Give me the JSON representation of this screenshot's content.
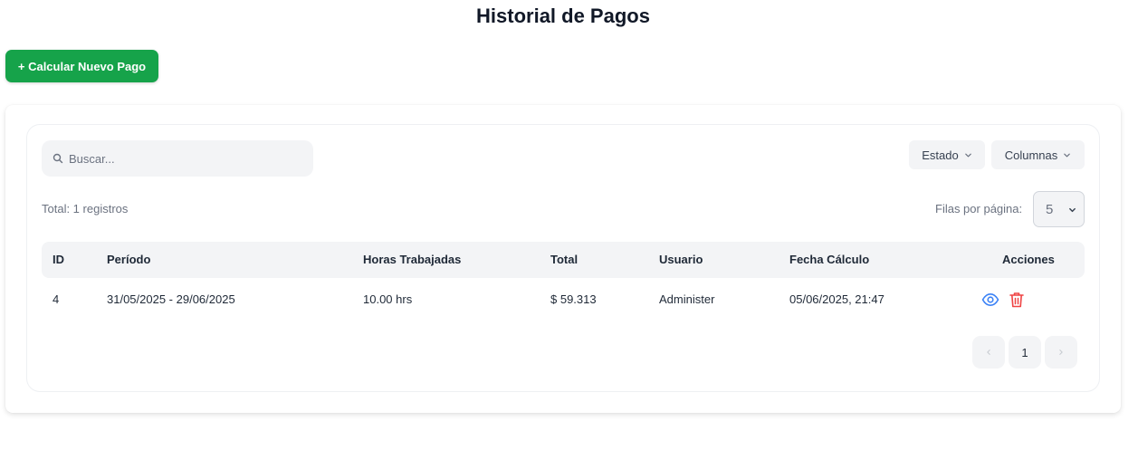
{
  "page": {
    "title": "Historial de Pagos"
  },
  "toolbar": {
    "new_label": "+ Calcular Nuevo Pago"
  },
  "search": {
    "placeholder": "Buscar...",
    "value": ""
  },
  "filters": {
    "estado_label": "Estado",
    "columnas_label": "Columnas"
  },
  "summary": {
    "total_text": "Total: 1 registros"
  },
  "pagination": {
    "rows_label": "Filas por página:",
    "rows_value": "5",
    "current_page": "1"
  },
  "table": {
    "headers": [
      "ID",
      "Período",
      "Horas Trabajadas",
      "Total",
      "Usuario",
      "Fecha Cálculo",
      "Acciones"
    ],
    "rows": [
      [
        "4",
        "31/05/2025 - 29/06/2025",
        "10.00 hrs",
        "$ 59.313",
        "Administer",
        "05/06/2025, 21:47"
      ]
    ]
  },
  "colors": {
    "primary_green": "#16a34a",
    "view_blue": "#3b82f6",
    "delete_red": "#ef4444"
  },
  "icons": {
    "search": "search-icon",
    "chevron": "chevron-down-icon",
    "view": "eye-icon",
    "delete": "trash-icon"
  }
}
